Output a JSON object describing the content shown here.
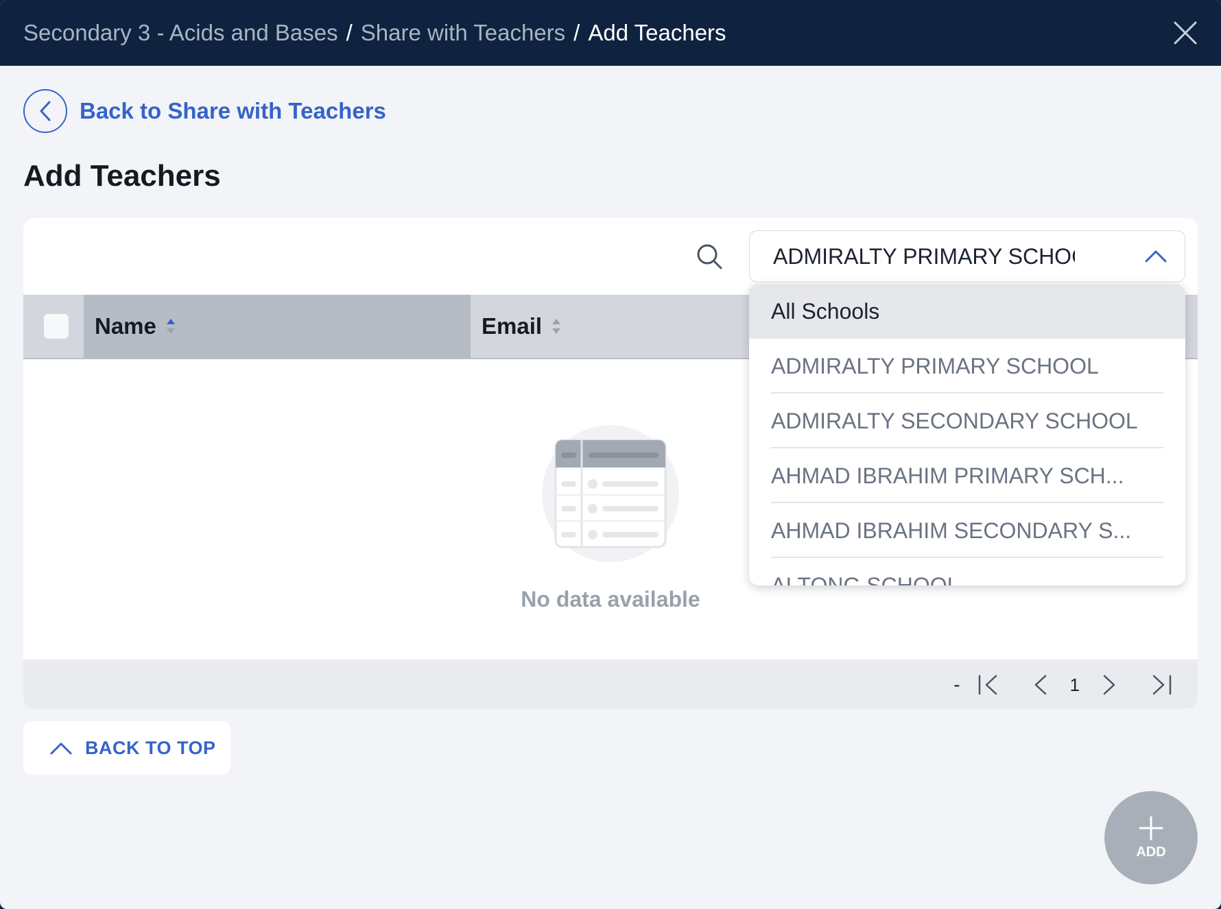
{
  "header": {
    "breadcrumb": [
      "Secondary 3 - Acids and Bases",
      "Share with Teachers"
    ],
    "current": "Add Teachers",
    "separator": "/"
  },
  "back_link": {
    "label": "Back to Share with Teachers"
  },
  "page_title": "Add Teachers",
  "filter": {
    "school_select_value": "ADMIRALTY PRIMARY SCHOC",
    "options": [
      "All Schools",
      "ADMIRALTY PRIMARY SCHOOL",
      "ADMIRALTY SECONDARY SCHOOL",
      "AHMAD IBRAHIM PRIMARY SCH...",
      "AHMAD IBRAHIM SECONDARY S...",
      "AI TONG SCHOOL"
    ],
    "highlighted_option": "All Schools"
  },
  "table": {
    "columns": [
      "Name",
      "Email"
    ],
    "empty_text": "No data available"
  },
  "pagination": {
    "range": "-",
    "page": "1"
  },
  "back_to_top": {
    "label": "BACK TO TOP"
  },
  "fab": {
    "label": "ADD"
  },
  "colors": {
    "header_bg": "#0f2340",
    "accent": "#3563c9",
    "page_bg": "#f3f4f7",
    "fab_bg": "#a8afb9"
  },
  "icons": [
    "close-icon",
    "chevron-left-icon",
    "search-icon",
    "chevron-up-icon",
    "sort-icon",
    "first-page-icon",
    "prev-page-icon",
    "next-page-icon",
    "last-page-icon",
    "plus-icon"
  ]
}
